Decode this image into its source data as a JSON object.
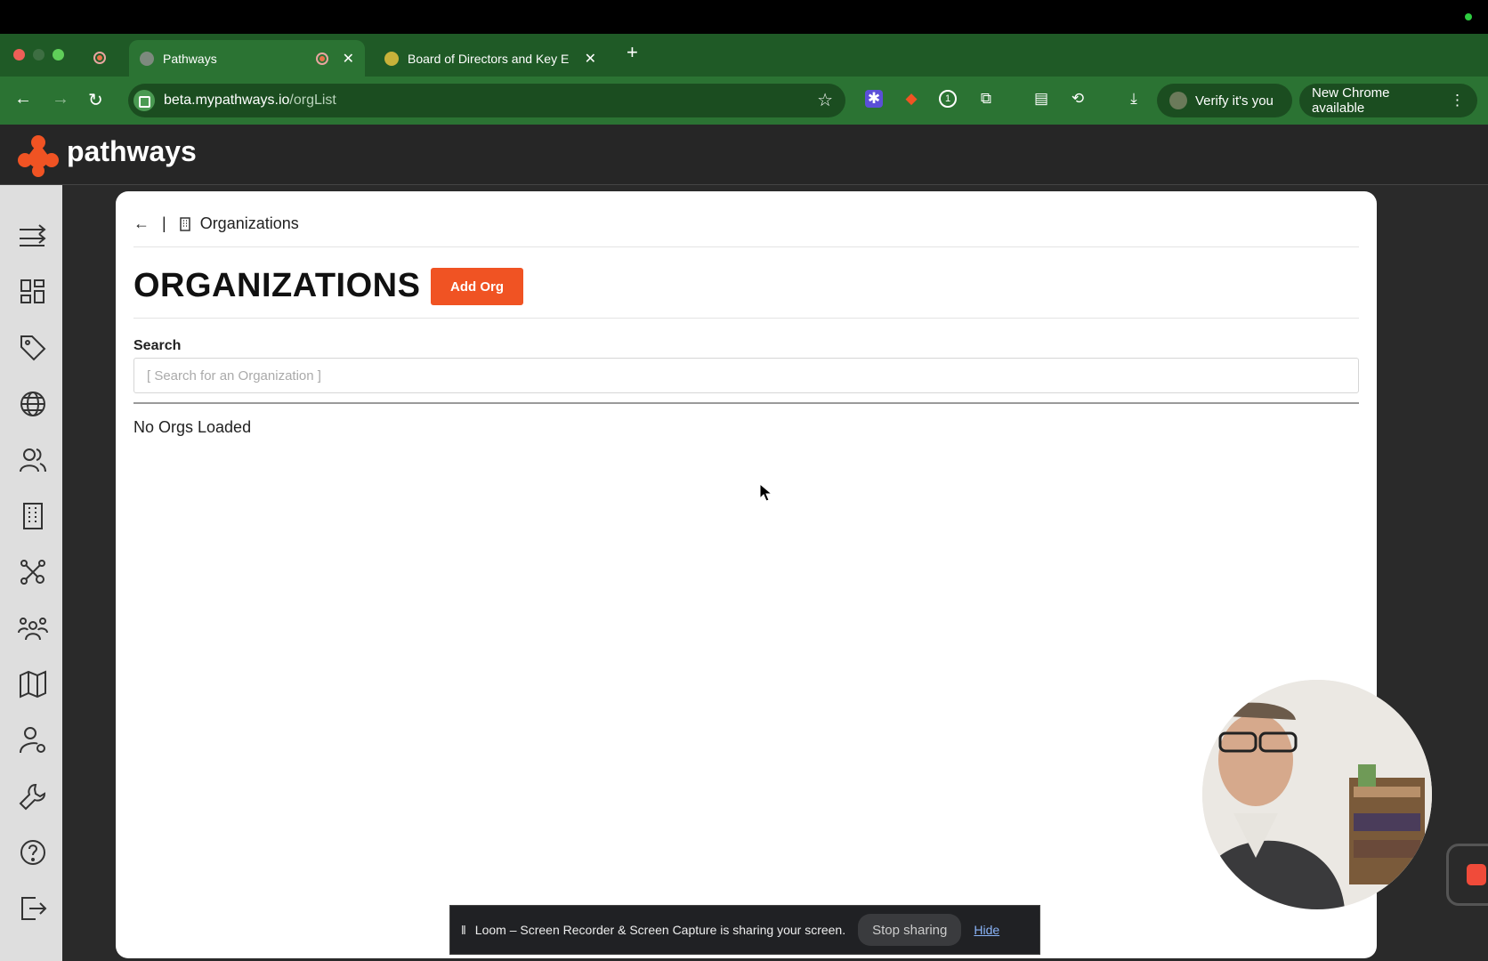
{
  "browser": {
    "tabs": [
      {
        "title": "Pathways",
        "active": true
      },
      {
        "title": "Board of Directors and Key E",
        "active": false
      }
    ],
    "address": {
      "host": "beta.mypathways.io",
      "path": "/orgList"
    },
    "profile_label": "Verify it's you",
    "update_label": "New Chrome available"
  },
  "app": {
    "logo_text": "pathways",
    "accent": "#f05323",
    "sidebar_icons": [
      "collapse-icon",
      "dashboard-icon",
      "tag-icon",
      "globe-icon",
      "users-icon",
      "building-icon",
      "network-icon",
      "community-icon",
      "map-icon",
      "person-location-icon",
      "wrench-icon",
      "help-icon",
      "logout-icon"
    ]
  },
  "page": {
    "breadcrumb": "Organizations",
    "title": "ORGANIZATIONS",
    "add_button": "Add Org",
    "search_label": "Search",
    "search_placeholder": "[ Search for an Organization ]",
    "empty_message": "No Orgs Loaded"
  },
  "share_bar": {
    "message": "Loom – Screen Recorder & Screen Capture is sharing your screen.",
    "stop_label": "Stop sharing",
    "hide_label": "Hide"
  }
}
